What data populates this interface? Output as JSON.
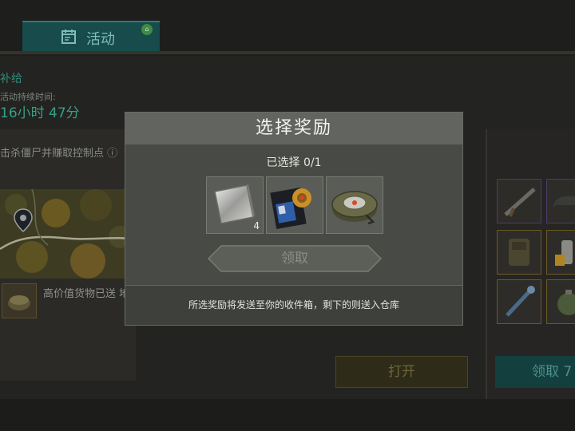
{
  "tabs": {
    "active_label": "活动"
  },
  "event": {
    "name": "补给",
    "duration_label": "活动持续时间:",
    "duration_value": "16小时 47分",
    "description": "击杀僵尸并赚取控制点",
    "notice": "高价值货物已送 地!"
  },
  "buttons": {
    "open_label": "打开",
    "claim_label": "领取 7"
  },
  "modal": {
    "title": "选择奖励",
    "selection_count": "已选择 0/1",
    "rewards": [
      {
        "name": "metal-plate",
        "quantity": "4"
      },
      {
        "name": "police-badge-wallet",
        "quantity": ""
      },
      {
        "name": "landmine",
        "quantity": ""
      }
    ],
    "claim_label": "领取",
    "footer_note": "所选奖励将发送至你的收件箱，剩下的则送入仓库"
  },
  "colors": {
    "accent_teal": "#2c7c7b",
    "modal_bg": "#484a45",
    "gold_frame": "#6a5a24"
  }
}
